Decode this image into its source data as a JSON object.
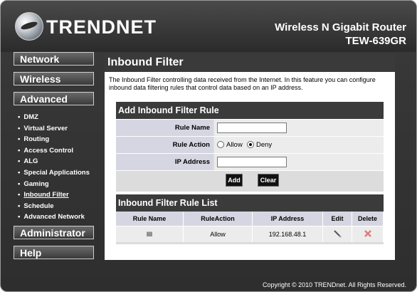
{
  "header": {
    "logo_text": "TRENDNET",
    "product_name": "Wireless N Gigabit Router",
    "model": "TEW-639GR"
  },
  "sidebar": {
    "network": "Network",
    "wireless": "Wireless",
    "advanced": "Advanced",
    "advanced_items": [
      {
        "label": "DMZ"
      },
      {
        "label": "Virtual Server"
      },
      {
        "label": "Routing"
      },
      {
        "label": "Access Control"
      },
      {
        "label": "ALG"
      },
      {
        "label": "Special Applications"
      },
      {
        "label": "Gaming"
      },
      {
        "label": "Inbound Filter"
      },
      {
        "label": "Schedule"
      },
      {
        "label": "Advanced Network"
      }
    ],
    "administrator": "Administrator",
    "help": "Help"
  },
  "main": {
    "title": "Inbound Filter",
    "description": "The Inbound Filter controlling data received from the Internet. In this feature you can configure inbound data filtering rules that control data based on an IP address.",
    "add_panel": {
      "title": "Add Inbound Filter Rule",
      "rule_name_label": "Rule Name",
      "rule_name_value": "",
      "rule_action_label": "Rule Action",
      "allow_label": "Allow",
      "deny_label": "Deny",
      "selected_action": "Deny",
      "ip_address_label": "IP Address",
      "ip_address_value": "",
      "add_button": "Add",
      "clear_button": "Clear"
    },
    "list_panel": {
      "title": "Inbound Filter Rule List",
      "columns": [
        "Rule Name",
        "RuleAction",
        "IP Address",
        "Edit",
        "Delete"
      ],
      "rows": [
        {
          "rule_name": "llll",
          "action": "Allow",
          "ip": "192.168.48.1"
        }
      ]
    }
  },
  "footer": {
    "copyright": "Copyright © 2010 TRENDnet. All Rights Reserved."
  },
  "colors": {
    "background": "#2e2e2e",
    "panel_header": "#3b3b3b",
    "label_cell": "#d6d6e3",
    "delete_icon": "#e07b7b"
  }
}
